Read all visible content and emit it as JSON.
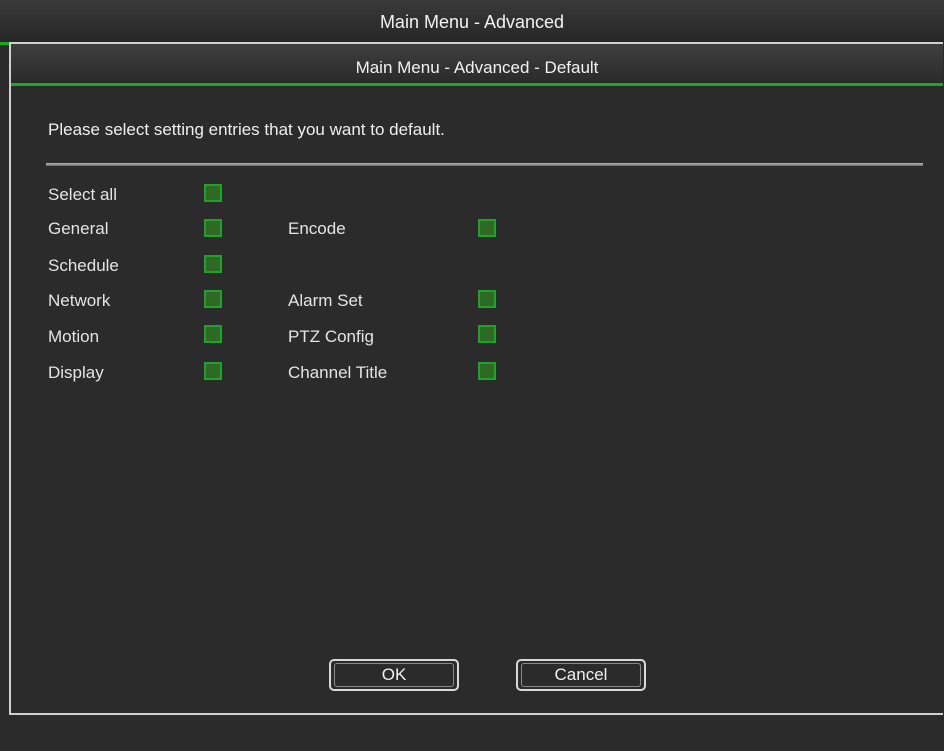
{
  "window": {
    "title": "Main Menu - Advanced"
  },
  "dialog": {
    "title": "Main Menu - Advanced - Default",
    "instruction": "Please select setting entries that you want to default."
  },
  "options": {
    "select_all": "Select all",
    "general": "General",
    "encode": "Encode",
    "schedule": "Schedule",
    "network": "Network",
    "alarm_set": "Alarm Set",
    "motion": "Motion",
    "ptz_config": "PTZ Config",
    "display": "Display",
    "channel_title": "Channel Title"
  },
  "buttons": {
    "ok": "OK",
    "cancel": "Cancel"
  },
  "colors": {
    "accent": "#1fa52a",
    "checkbox_fill": "#2e6a23",
    "background": "#2b2b2b"
  }
}
